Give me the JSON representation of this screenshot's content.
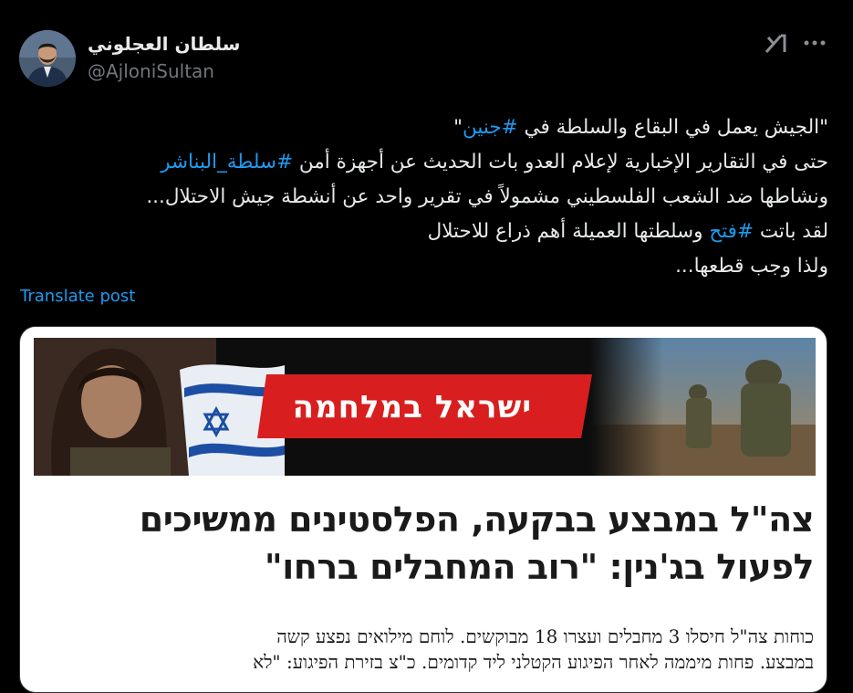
{
  "author": {
    "display_name": "سلطان العجلوني",
    "handle": "@AjloniSultan",
    "avatar_icon": "avatar-photo"
  },
  "toolbar": {
    "grok_icon": "grok-icon",
    "more_icon": "more-icon"
  },
  "post": {
    "lines": [
      [
        {
          "t": "\"الجيش يعمل في البقاع والسلطة في "
        },
        {
          "t": "#جنين",
          "tag": true
        },
        {
          "t": "\""
        }
      ],
      [
        {
          "t": "حتى في التقارير الإخبارية لإعلام العدو بات الحديث عن أجهزة أمن "
        },
        {
          "t": "#سلطة_البناشر",
          "tag": true
        }
      ],
      [
        {
          "t": "ونشاطها ضد الشعب الفلسطيني مشمولاً في تقرير واحد عن أنشطة جيش الاحتلال..."
        }
      ],
      [
        {
          "t": "لقد باتت "
        },
        {
          "t": "#فتح",
          "tag": true
        },
        {
          "t": " وسلطتها العميلة أهم ذراع للاحتلال"
        }
      ],
      [
        {
          "t": "ولذا وجب قطعها..."
        }
      ]
    ],
    "translate_label": "Translate post"
  },
  "media": {
    "banner_title": "ישראל במלחמה",
    "headline_lines": [
      "צה\"ל במבצע בבקעה, הפלסטינים ממשיכים",
      "לפעול בג'נין: \"רוב המחבלים ברחו\""
    ],
    "body_lines": [
      "כוחות צה\"ל חיסלו 3 מחבלים ועצרו 18 מבוקשים. לוחם מילואים נפצע קשה",
      "במבצע. פחות מיממה לאחר הפיגוע הקטלני ליד קדומים. כ\"צ בזירת הפיגוע: \"לא"
    ]
  },
  "colors": {
    "background": "#000000",
    "text": "#e7e9ea",
    "muted": "#71767b",
    "link": "#1d9bf0",
    "banner_red": "#d81e1e",
    "flag_blue": "#1c4ea3"
  }
}
